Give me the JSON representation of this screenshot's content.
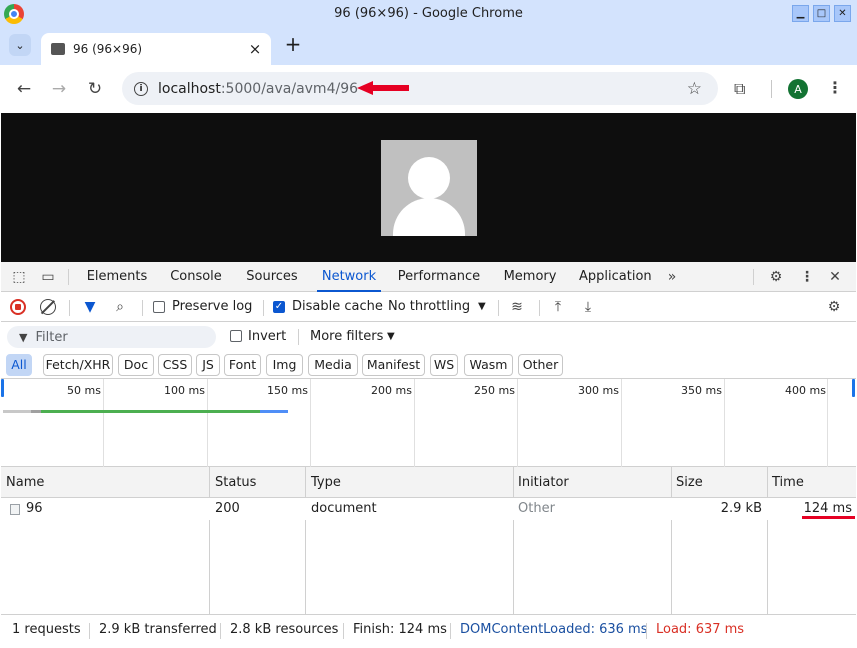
{
  "window": {
    "title": "96 (96×96) - Google Chrome"
  },
  "tab": {
    "label": "96 (96×96)"
  },
  "address": {
    "host": "localhost",
    "path": ":5000/ava/avm4/96"
  },
  "profile": {
    "initial": "A",
    "color": "#137333"
  },
  "devtools": {
    "tabs": [
      "Elements",
      "Console",
      "Sources",
      "Network",
      "Performance",
      "Memory",
      "Application"
    ],
    "active_tab": "Network",
    "toolbar": {
      "preserve_log": "Preserve log",
      "disable_cache": "Disable cache",
      "throttling": "No throttling"
    },
    "filter": {
      "placeholder": "Filter",
      "invert": "Invert",
      "more_filters": "More filters"
    },
    "types": [
      "All",
      "Fetch/XHR",
      "Doc",
      "CSS",
      "JS",
      "Font",
      "Img",
      "Media",
      "Manifest",
      "WS",
      "Wasm",
      "Other"
    ],
    "timeline_labels": [
      "50 ms",
      "100 ms",
      "150 ms",
      "200 ms",
      "250 ms",
      "300 ms",
      "350 ms",
      "400 ms"
    ],
    "columns": [
      "Name",
      "Status",
      "Type",
      "Initiator",
      "Size",
      "Time"
    ],
    "rows": [
      {
        "name": "96",
        "status": "200",
        "type": "document",
        "initiator": "Other",
        "size": "2.9 kB",
        "time": "124 ms"
      }
    ],
    "summary": {
      "requests": "1 requests",
      "transferred": "2.9 kB transferred",
      "resources": "2.8 kB resources",
      "finish": "Finish: 124 ms",
      "dom_content_loaded": "DOMContentLoaded: 636 ms",
      "load": "Load: 637 ms"
    }
  },
  "colors": {
    "accent": "#0b57d0",
    "dcl": "#1a4fa0",
    "load": "#d93025",
    "annotation": "#e60023"
  }
}
